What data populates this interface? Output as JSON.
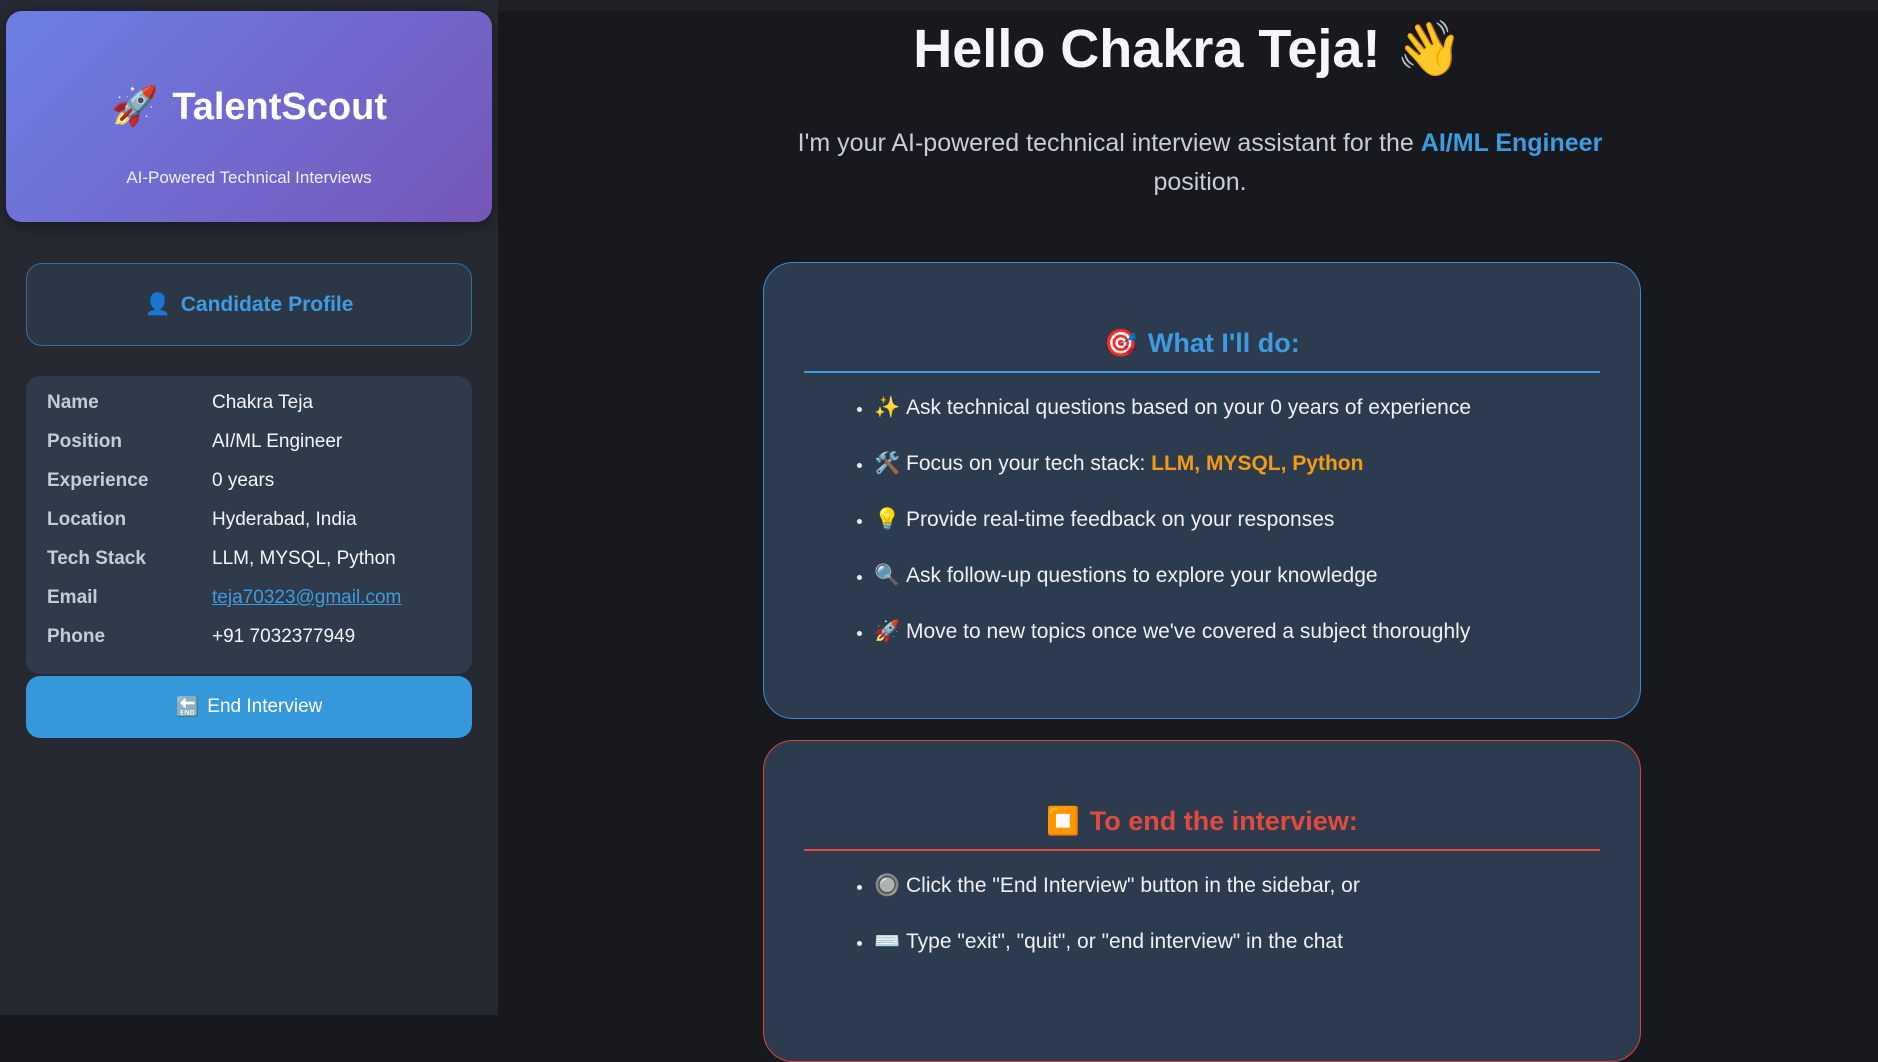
{
  "sidebar": {
    "brand": {
      "icon": "🚀",
      "title": "TalentScout",
      "subtitle": "AI-Powered Technical Interviews"
    },
    "profile_header": {
      "icon": "👤",
      "label": "Candidate Profile"
    },
    "profile": {
      "rows": [
        {
          "label": "Name",
          "value": "Chakra Teja"
        },
        {
          "label": "Position",
          "value": "AI/ML Engineer"
        },
        {
          "label": "Experience",
          "value": "0 years"
        },
        {
          "label": "Location",
          "value": "Hyderabad, India"
        },
        {
          "label": "Tech Stack",
          "value": "LLM, MYSQL, Python"
        },
        {
          "label": "Email",
          "value": "teja70323@gmail.com"
        },
        {
          "label": "Phone",
          "value": "+91 7032377949"
        }
      ]
    },
    "end_button": {
      "icon": "🔚",
      "label": "End Interview"
    }
  },
  "main": {
    "greeting": "Hello Chakra Teja!",
    "greeting_icon": "👋",
    "intro_prefix": "I'm your AI-powered technical interview assistant for the",
    "intro_position": "AI/ML Engineer",
    "intro_suffix": "position.",
    "what_card": {
      "icon": "🎯",
      "title": "What I'll do:",
      "items": [
        {
          "icon": "✨",
          "text": "Ask technical questions based on your 0 years of experience"
        },
        {
          "icon": "🛠️",
          "text": "Focus on your tech stack:",
          "highlight": "LLM, MYSQL, Python"
        },
        {
          "icon": "💡",
          "text": "Provide real-time feedback on your responses"
        },
        {
          "icon": "🔍",
          "text": "Ask follow-up questions to explore your knowledge"
        },
        {
          "icon": "🚀",
          "text": "Move to new topics once we've covered a subject thoroughly"
        }
      ]
    },
    "end_card": {
      "icon": "⏹️",
      "title": "To end the interview:",
      "items": [
        {
          "icon": "🔘",
          "text": "Click the \"End Interview\" button in the sidebar, or"
        },
        {
          "icon": "⌨️",
          "text": "Type \"exit\", \"quit\", or \"end interview\" in the chat"
        }
      ]
    }
  },
  "colors": {
    "accent_blue": "#3d9be0",
    "accent_red": "#e14a3c",
    "accent_orange": "#f39c12",
    "brand_gradient_start": "#6c7fe6",
    "brand_gradient_end": "#7656b8"
  }
}
